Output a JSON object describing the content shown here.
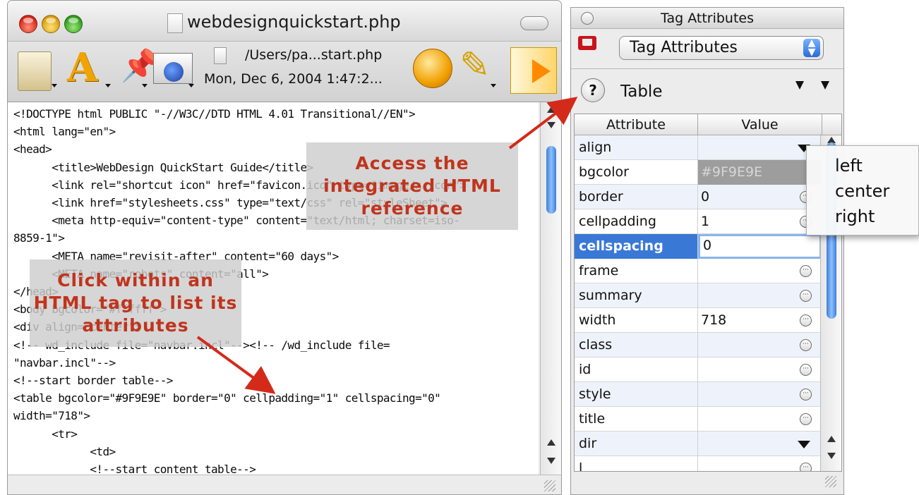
{
  "editor": {
    "title": "webdesignquickstart.php",
    "path": "/Users/pa...start.php",
    "date": "Mon, Dec 6, 2004 1:47:2..."
  },
  "code_lines": [
    "<!DOCTYPE html PUBLIC \"-//W3C//DTD HTML 4.01 Transitional//EN\">",
    "<html lang=\"en\">",
    "<head>",
    "      <title>WebDesign QuickStart Guide</title>",
    "      <link rel=\"shortcut icon\" href=\"favicon.ico\" type=\"image/x-icon\">",
    "      <link href=\"stylesheets.css\" type=\"text/css\" rel=\"styleSheet\">",
    "      <meta http-equiv=\"content-type\" content=\"text/html; charset=iso-",
    "8859-1\">",
    "      <META name=\"revisit-after\" content=\"60 days\">",
    "      <META name=\"robots\" content=\"all\">",
    "</head>",
    "<body bgcolor=\"#ffffff\">",
    "<div align=\"center\">",
    "<!-- wd_include file=\"navbar.incl\"--><!-- /wd_include file=",
    "\"navbar.incl\"-->",
    "<!--start border table-->",
    "<table bgcolor=\"#9F9E9E\" border=\"0\" cellpadding=\"1\" cellspacing=\"0\"",
    "width=\"718\">",
    "      <tr>",
    "            <td>",
    "            <!--start content table-->"
  ],
  "palette": {
    "window_title": "Tag Attributes",
    "popup_label": "Tag Attributes",
    "tag_name": "Table",
    "help_label": "?",
    "col_attribute": "Attribute",
    "col_value": "Value",
    "rows": [
      {
        "attr": "align",
        "value": "",
        "control": "dropdown"
      },
      {
        "attr": "bgcolor",
        "value": "#9F9E9E",
        "control": "none"
      },
      {
        "attr": "border",
        "value": "0",
        "control": "ellipsis"
      },
      {
        "attr": "cellpadding",
        "value": "1",
        "control": "ellipsis"
      },
      {
        "attr": "cellspacing",
        "value": "0",
        "control": "none"
      },
      {
        "attr": "frame",
        "value": "",
        "control": "ellipsis"
      },
      {
        "attr": "summary",
        "value": "",
        "control": "ellipsis"
      },
      {
        "attr": "width",
        "value": "718",
        "control": "ellipsis"
      },
      {
        "attr": "class",
        "value": "",
        "control": "ellipsis"
      },
      {
        "attr": "id",
        "value": "",
        "control": "ellipsis"
      },
      {
        "attr": "style",
        "value": "",
        "control": "ellipsis"
      },
      {
        "attr": "title",
        "value": "",
        "control": "ellipsis"
      },
      {
        "attr": "dir",
        "value": "",
        "control": "dropdown"
      },
      {
        "attr": "l",
        "value": "",
        "control": "ellipsis"
      }
    ],
    "selected_attr": "cellspacing"
  },
  "align_menu": [
    "left",
    "center",
    "right"
  ],
  "callouts": {
    "reference": "Access the integrated HTML reference",
    "click_tag": "Click within an HTML tag to list its attributes"
  },
  "colors": {
    "callout_text": "#c0341d",
    "arrow": "#d42a1a",
    "selection": "#3a78d6"
  }
}
